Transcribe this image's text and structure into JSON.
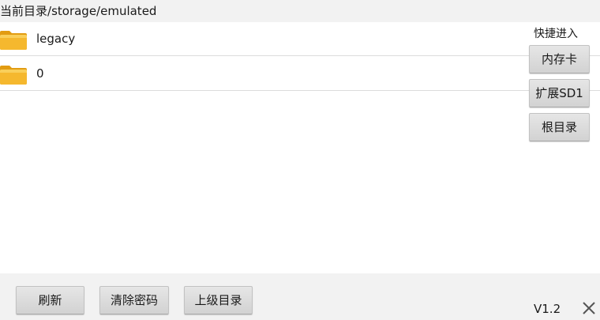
{
  "path": {
    "label": "当前目录",
    "value": "/storage/emulated"
  },
  "files": [
    {
      "name": "legacy",
      "icon": "folder-icon"
    },
    {
      "name": "0",
      "icon": "folder-icon"
    }
  ],
  "quick_access": {
    "title": "快捷进入",
    "buttons": [
      "内存卡",
      "扩展SD1",
      "根目录"
    ]
  },
  "bottom_bar": {
    "refresh_label": "刷新",
    "clear_password_label": "清除密码",
    "parent_dir_label": "上级目录",
    "version": "V1.2"
  },
  "colors": {
    "folder": "#f5b82e",
    "folder_dark": "#e29c12",
    "background": "#f2f2f2",
    "list_background": "#ffffff",
    "divider": "#dcdcdc"
  }
}
